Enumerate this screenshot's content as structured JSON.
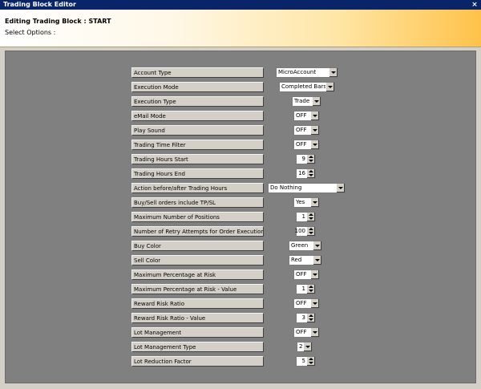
{
  "window": {
    "title": "Trading Block Editor",
    "close_glyph": "×"
  },
  "header": {
    "title": "Editing Trading Block : START",
    "subtitle": "Select Options :"
  },
  "fields": [
    {
      "label": "Account Type",
      "value": "MicroAccount",
      "kind": "dropdown"
    },
    {
      "label": "Execution Mode",
      "value": "Completed Bars",
      "kind": "dropdown"
    },
    {
      "label": "Execution Type",
      "value": "Trade",
      "kind": "dropdown"
    },
    {
      "label": "eMail Mode",
      "value": "OFF",
      "kind": "dropdown"
    },
    {
      "label": "Play Sound",
      "value": "OFF",
      "kind": "dropdown"
    },
    {
      "label": "Trading Time Filter",
      "value": "OFF",
      "kind": "dropdown"
    },
    {
      "label": "Trading Hours Start",
      "value": "9",
      "kind": "spinner"
    },
    {
      "label": "Trading Hours End",
      "value": "16",
      "kind": "spinner"
    },
    {
      "label": "Action before/after Trading Hours",
      "value": "Do Nothing",
      "kind": "dropdown"
    },
    {
      "label": "Buy/Sell orders include TP/SL",
      "value": "Yes",
      "kind": "dropdown"
    },
    {
      "label": "Maximum Number of Positions",
      "value": "1",
      "kind": "spinner"
    },
    {
      "label": "Number of Retry Attempts for Order Execution",
      "value": "100",
      "kind": "spinner"
    },
    {
      "label": "Buy Color",
      "value": "Green",
      "kind": "dropdown"
    },
    {
      "label": "Sell Color",
      "value": "Red",
      "kind": "dropdown"
    },
    {
      "label": "Maximum Percentage at Risk",
      "value": "OFF",
      "kind": "dropdown"
    },
    {
      "label": "Maximum Percentage at Risk - Value",
      "value": "1",
      "kind": "spinner"
    },
    {
      "label": "Reward Risk Ratio",
      "value": "OFF",
      "kind": "dropdown"
    },
    {
      "label": "Reward Risk Ratio - Value",
      "value": "3",
      "kind": "spinner"
    },
    {
      "label": "Lot Management",
      "value": "OFF",
      "kind": "dropdown"
    },
    {
      "label": "Lot Management Type",
      "value": "2",
      "kind": "dropdown"
    },
    {
      "label": "Lot Reduction Factor",
      "value": "5",
      "kind": "spinner"
    }
  ]
}
